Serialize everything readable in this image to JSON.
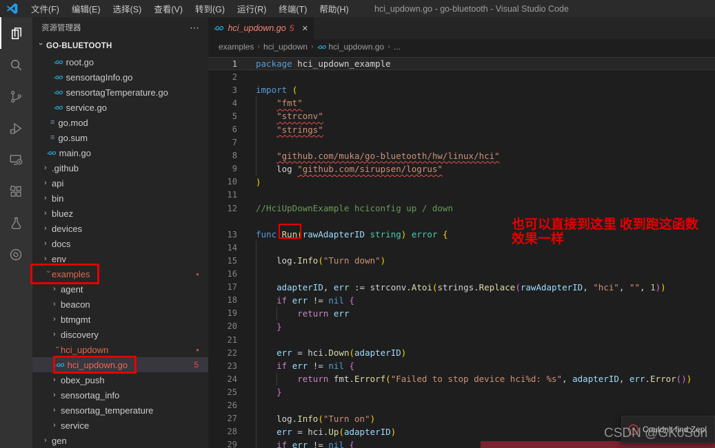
{
  "title_bar": {
    "menus": [
      "文件(F)",
      "编辑(E)",
      "选择(S)",
      "查看(V)",
      "转到(G)",
      "运行(R)",
      "终端(T)",
      "帮助(H)"
    ],
    "window_title": "hci_updown.go - go-bluetooth - Visual Studio Code"
  },
  "activity_bar": {
    "icons": [
      {
        "name": "explorer-icon",
        "active": true
      },
      {
        "name": "search-icon",
        "active": false
      },
      {
        "name": "source-control-icon",
        "active": false
      },
      {
        "name": "run-debug-icon",
        "active": false
      },
      {
        "name": "remote-explorer-icon",
        "active": false
      },
      {
        "name": "extensions-icon",
        "active": false
      },
      {
        "name": "testing-icon",
        "active": false
      },
      {
        "name": "link-extension-icon",
        "active": false
      }
    ]
  },
  "sidebar": {
    "header": "资源管理器",
    "header_actions": "⋯",
    "section": "GO-BLUETOOTH",
    "items": [
      {
        "label": "root.go",
        "icon": "go",
        "pad": 31
      },
      {
        "label": "sensortagInfo.go",
        "icon": "go",
        "pad": 31
      },
      {
        "label": "sensortagTemperature.go",
        "icon": "go",
        "pad": 31
      },
      {
        "label": "service.go",
        "icon": "go",
        "pad": 31
      },
      {
        "label": "go.mod",
        "icon": "mod",
        "pad": 26
      },
      {
        "label": "go.sum",
        "icon": "mod",
        "pad": 26
      },
      {
        "label": "main.go",
        "icon": "go",
        "pad": 21
      },
      {
        "label": ".github",
        "icon": "chev",
        "pad": 17
      },
      {
        "label": "api",
        "icon": "chev",
        "pad": 17
      },
      {
        "label": "bin",
        "icon": "chev",
        "pad": 17
      },
      {
        "label": "bluez",
        "icon": "chev",
        "pad": 17
      },
      {
        "label": "devices",
        "icon": "chev",
        "pad": 17
      },
      {
        "label": "docs",
        "icon": "chev",
        "pad": 17
      },
      {
        "label": "env",
        "icon": "chev",
        "pad": 17
      },
      {
        "label": "examples",
        "icon": "chev-open",
        "pad": 17,
        "state": "modified",
        "dot": true
      },
      {
        "label": "agent",
        "icon": "chev",
        "pad": 30
      },
      {
        "label": "beacon",
        "icon": "chev",
        "pad": 30
      },
      {
        "label": "btmgmt",
        "icon": "chev",
        "pad": 30
      },
      {
        "label": "discovery",
        "icon": "chev",
        "pad": 30
      },
      {
        "label": "hci_updown",
        "icon": "chev-open",
        "pad": 30,
        "state": "modified",
        "dot": true
      },
      {
        "label": "hci_updown.go",
        "icon": "go",
        "pad": 33,
        "state": "error",
        "badge": "5",
        "selected": true
      },
      {
        "label": "obex_push",
        "icon": "chev",
        "pad": 30
      },
      {
        "label": "sensortag_info",
        "icon": "chev",
        "pad": 30
      },
      {
        "label": "sensortag_temperature",
        "icon": "chev",
        "pad": 30
      },
      {
        "label": "service",
        "icon": "chev",
        "pad": 30
      },
      {
        "label": "gen",
        "icon": "chev",
        "pad": 17
      }
    ]
  },
  "editor": {
    "tab": {
      "label": "hci_updown.go",
      "badge": "5",
      "close": "✕"
    },
    "breadcrumbs": [
      "examples",
      "hci_updown",
      "hci_updown.go",
      "..."
    ],
    "lines": [
      {
        "n": 1,
        "cur": true,
        "t": [
          [
            "package",
            "kw"
          ],
          [
            " hci_updown_example",
            "fg"
          ]
        ]
      },
      {
        "n": 2,
        "t": []
      },
      {
        "n": 3,
        "t": [
          [
            "import",
            "kw"
          ],
          [
            " ",
            "fg"
          ],
          [
            "(",
            "b1"
          ]
        ]
      },
      {
        "n": 4,
        "t": [
          [
            "    ",
            "fg"
          ],
          [
            "\"fmt\"",
            "str sq"
          ]
        ]
      },
      {
        "n": 5,
        "t": [
          [
            "    ",
            "fg"
          ],
          [
            "\"strconv\"",
            "str sq"
          ]
        ]
      },
      {
        "n": 6,
        "t": [
          [
            "    ",
            "fg"
          ],
          [
            "\"strings\"",
            "str sq"
          ]
        ]
      },
      {
        "n": 7,
        "t": []
      },
      {
        "n": 8,
        "t": [
          [
            "    ",
            "fg"
          ],
          [
            "\"github.com/muka/go-bluetooth/hw/linux/hci\"",
            "str sq"
          ]
        ]
      },
      {
        "n": 9,
        "t": [
          [
            "    log ",
            "fg"
          ],
          [
            "\"github.com/sirupsen/logrus\"",
            "str sq"
          ]
        ]
      },
      {
        "n": 10,
        "t": [
          [
            ")",
            "b1"
          ]
        ]
      },
      {
        "n": 11,
        "t": []
      },
      {
        "n": 12,
        "t": [
          [
            "//HciUpDownExample hciconfig up / down",
            "com"
          ]
        ]
      },
      {
        "n": null,
        "t": []
      },
      {
        "n": 13,
        "t": [
          [
            "func",
            "kw"
          ],
          [
            " ",
            "fg"
          ],
          [
            "Run",
            "fn"
          ],
          [
            "(",
            "b1"
          ],
          [
            "rawAdapterID",
            "var"
          ],
          [
            " ",
            "fg"
          ],
          [
            "string",
            "type"
          ],
          [
            ")",
            "b1"
          ],
          [
            " ",
            "fg"
          ],
          [
            "error",
            "type"
          ],
          [
            " ",
            "fg"
          ],
          [
            "{",
            "b1"
          ]
        ]
      },
      {
        "n": 14,
        "t": []
      },
      {
        "n": 15,
        "t": [
          [
            "    log.",
            "fg"
          ],
          [
            "Info",
            "fn"
          ],
          [
            "(",
            "b1"
          ],
          [
            "\"Turn down\"",
            "str"
          ],
          [
            ")",
            "b1"
          ]
        ]
      },
      {
        "n": 16,
        "t": []
      },
      {
        "n": 17,
        "t": [
          [
            "    ",
            "fg"
          ],
          [
            "adapterID",
            "var"
          ],
          [
            ", ",
            "fg"
          ],
          [
            "err",
            "var"
          ],
          [
            " := strconv.",
            "fg"
          ],
          [
            "Atoi",
            "fn"
          ],
          [
            "(",
            "b1"
          ],
          [
            "strings.",
            "fg"
          ],
          [
            "Replace",
            "fn"
          ],
          [
            "(",
            "b2"
          ],
          [
            "rawAdapterID",
            "var"
          ],
          [
            ", ",
            "fg"
          ],
          [
            "\"hci\"",
            "str"
          ],
          [
            ", ",
            "fg"
          ],
          [
            "\"\"",
            "str"
          ],
          [
            ", ",
            "fg"
          ],
          [
            "1",
            "num"
          ],
          [
            ")",
            "b2"
          ],
          [
            ")",
            "b1"
          ]
        ]
      },
      {
        "n": 18,
        "t": [
          [
            "    ",
            "fg"
          ],
          [
            "if",
            "ctrl"
          ],
          [
            " ",
            "fg"
          ],
          [
            "err",
            "var"
          ],
          [
            " != ",
            "fg"
          ],
          [
            "nil",
            "kw"
          ],
          [
            " ",
            "fg"
          ],
          [
            "{",
            "b2"
          ]
        ]
      },
      {
        "n": 19,
        "t": [
          [
            "        ",
            "fg"
          ],
          [
            "return",
            "ctrl"
          ],
          [
            " ",
            "fg"
          ],
          [
            "err",
            "var"
          ]
        ]
      },
      {
        "n": 20,
        "t": [
          [
            "    ",
            "fg"
          ],
          [
            "}",
            "b2"
          ]
        ]
      },
      {
        "n": 21,
        "t": []
      },
      {
        "n": 22,
        "t": [
          [
            "    ",
            "fg"
          ],
          [
            "err",
            "var"
          ],
          [
            " = hci.",
            "fg"
          ],
          [
            "Down",
            "fn"
          ],
          [
            "(",
            "b1"
          ],
          [
            "adapterID",
            "var"
          ],
          [
            ")",
            "b1"
          ]
        ]
      },
      {
        "n": 23,
        "t": [
          [
            "    ",
            "fg"
          ],
          [
            "if",
            "ctrl"
          ],
          [
            " ",
            "fg"
          ],
          [
            "err",
            "var"
          ],
          [
            " != ",
            "fg"
          ],
          [
            "nil",
            "kw"
          ],
          [
            " ",
            "fg"
          ],
          [
            "{",
            "b2"
          ]
        ]
      },
      {
        "n": 24,
        "t": [
          [
            "        ",
            "fg"
          ],
          [
            "return",
            "ctrl"
          ],
          [
            " fmt.",
            "fg"
          ],
          [
            "Errorf",
            "fn"
          ],
          [
            "(",
            "b1"
          ],
          [
            "\"Failed to stop device hci%d: %s\"",
            "str"
          ],
          [
            ", ",
            "fg"
          ],
          [
            "adapterID",
            "var"
          ],
          [
            ", ",
            "fg"
          ],
          [
            "err",
            "var"
          ],
          [
            ".",
            "fg"
          ],
          [
            "Error",
            "fn"
          ],
          [
            "(",
            "b2"
          ],
          [
            ")",
            "b2"
          ],
          [
            ")",
            "b1"
          ]
        ]
      },
      {
        "n": 25,
        "t": [
          [
            "    ",
            "fg"
          ],
          [
            "}",
            "b2"
          ]
        ]
      },
      {
        "n": 26,
        "t": []
      },
      {
        "n": 27,
        "t": [
          [
            "    log.",
            "fg"
          ],
          [
            "Info",
            "fn"
          ],
          [
            "(",
            "b1"
          ],
          [
            "\"Turn on\"",
            "str"
          ],
          [
            ")",
            "b1"
          ]
        ]
      },
      {
        "n": 28,
        "t": [
          [
            "    ",
            "fg"
          ],
          [
            "err",
            "var"
          ],
          [
            " = hci.",
            "fg"
          ],
          [
            "Up",
            "fn"
          ],
          [
            "(",
            "b1"
          ],
          [
            "adapterID",
            "var"
          ],
          [
            ")",
            "b1"
          ]
        ]
      },
      {
        "n": 29,
        "t": [
          [
            "    ",
            "fg"
          ],
          [
            "if",
            "ctrl"
          ],
          [
            " ",
            "fg"
          ],
          [
            "err",
            "var"
          ],
          [
            " != ",
            "fg"
          ],
          [
            "nil",
            "kw"
          ],
          [
            " ",
            "fg"
          ],
          [
            "{",
            "b2"
          ]
        ]
      }
    ]
  },
  "annotations": {
    "note_line1": "也可以直接到这里 收到跑这函数",
    "note_line2": "效果一样"
  },
  "notification": {
    "text": "Couldn't find Zepl"
  },
  "watermark": "CSDN @GKoSon",
  "icons": {
    "go": "-GO",
    "mod": "≡",
    "chev": "›",
    "dot": "●",
    "close": "✕",
    "error_x": "✕",
    "dots": "⋯",
    "crumb_sep": "›"
  },
  "colors": {
    "annotation_red": "#e60000",
    "squiggle_error": "#f14c4c",
    "modified_item": "#dd6b4d",
    "error_file": "#f4645c",
    "maroon_bar": "#7c2230",
    "accent_blue": "#1f9cf0",
    "tokens": {
      "fg": "#d4d4d4",
      "kw": "#569cd6",
      "ctrl": "#c586c0",
      "str": "#ce9178",
      "fn": "#dcdcaa",
      "var": "#9cdcfe",
      "type": "#4ec9b0",
      "com": "#6a9955",
      "num": "#b5cea8",
      "b1": "#ffd700",
      "b2": "#da70d6"
    }
  }
}
